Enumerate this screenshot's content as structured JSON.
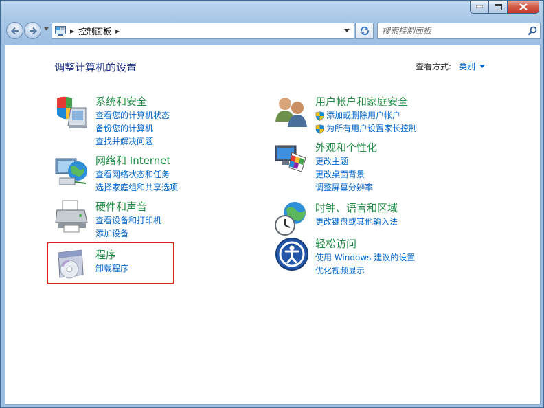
{
  "window": {
    "controls": {
      "minimize": "minimize",
      "maximize": "maximize",
      "close": "close"
    }
  },
  "nav": {
    "breadcrumb": "控制面板",
    "search_placeholder": "搜索控制面板"
  },
  "content": {
    "heading": "调整计算机的设置",
    "view_by_label": "查看方式:",
    "view_by_value": "类别"
  },
  "categories": [
    {
      "title": "系统和安全",
      "icon": "system-security-icon",
      "links": [
        "查看您的计算机状态",
        "备份您的计算机",
        "查找并解决问题"
      ]
    },
    {
      "title": "网络和 Internet",
      "icon": "network-globe-icon",
      "links": [
        "查看网络状态和任务",
        "选择家庭组和共享选项"
      ]
    },
    {
      "title": "硬件和声音",
      "icon": "printer-hardware-icon",
      "links": [
        "查看设备和打印机",
        "添加设备"
      ]
    },
    {
      "title": "程序",
      "icon": "programs-disc-icon",
      "links": [
        "卸载程序"
      ]
    },
    {
      "title": "用户帐户和家庭安全",
      "icon": "user-accounts-icon",
      "links": [
        "添加或删除用户帐户",
        "为所有用户设置家长控制"
      ]
    },
    {
      "title": "外观和个性化",
      "icon": "appearance-monitor-icon",
      "links": [
        "更改主题",
        "更改桌面背景",
        "调整屏幕分辨率"
      ]
    },
    {
      "title": "时钟、语言和区域",
      "icon": "clock-globe-icon",
      "links": [
        "更改键盘或其他输入法"
      ]
    },
    {
      "title": "轻松访问",
      "icon": "ease-of-access-icon",
      "links": [
        "使用 Windows 建议的设置",
        "优化视频显示"
      ]
    }
  ],
  "colors": {
    "title_green": "#1e8a44",
    "link_blue": "#0066cc",
    "heading_blue": "#1e3287",
    "highlight_red": "#e0201b"
  }
}
